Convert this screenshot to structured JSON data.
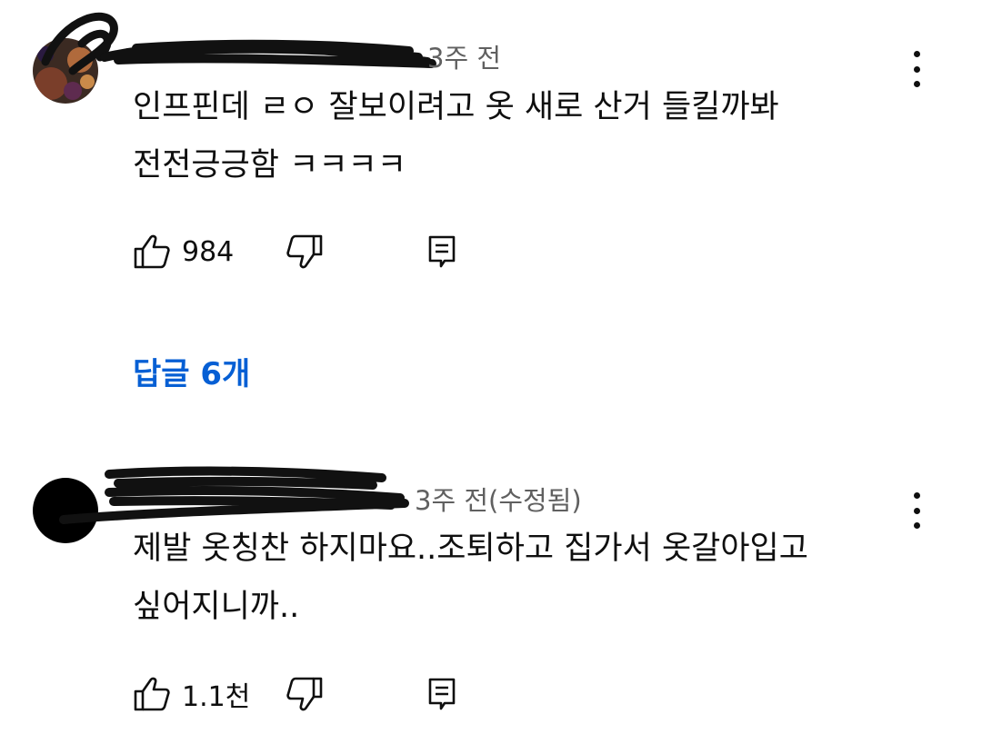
{
  "comments": [
    {
      "author": "",
      "time": "3주 전",
      "text_lines": [
        "인프핀데 ㄹㅇ 잘보이려고 옷 새로 산거 들킬까봐",
        "전전긍긍함 ㅋㅋㅋㅋ"
      ],
      "likes": "984",
      "icons": {
        "like": "thumbs-up-icon",
        "dislike": "thumbs-down-icon",
        "reply": "reply-icon",
        "menu": "more-vert-icon"
      }
    },
    {
      "author": "",
      "time": "3주 전(수정됨)",
      "text_lines": [
        "제발 옷칭찬 하지마요..조퇴하고 집가서 옷갈아입고",
        "싶어지니까.."
      ],
      "likes": "1.1천",
      "icons": {
        "like": "thumbs-up-icon",
        "dislike": "thumbs-down-icon",
        "reply": "reply-icon",
        "menu": "more-vert-icon"
      }
    }
  ],
  "replies_link": "답글 6개",
  "colors": {
    "link": "#065fd4",
    "meta": "#606060",
    "text": "#0f0f0f",
    "redaction": "#111111"
  }
}
